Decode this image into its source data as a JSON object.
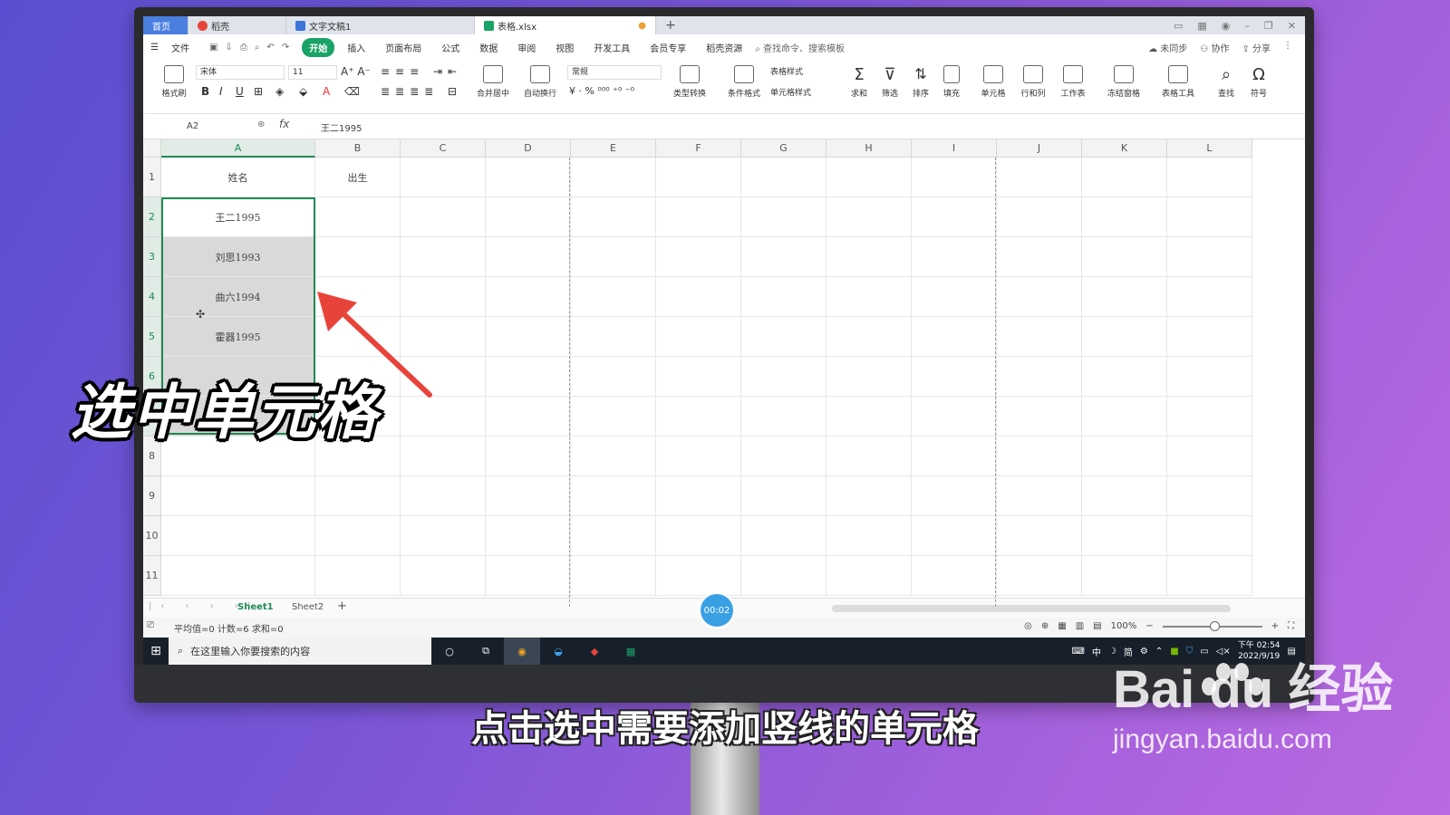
{
  "tabs": {
    "home": "首页",
    "wps": "稻壳",
    "doc": "文字文稿1",
    "sheet": "表格.xlsx",
    "plus": "+"
  },
  "menu": {
    "file": "文件",
    "items": [
      "开始",
      "插入",
      "页面布局",
      "公式",
      "数据",
      "审阅",
      "视图",
      "开发工具",
      "会员专享",
      "稻壳资源"
    ],
    "search": "查找命令、搜索模板",
    "sync": "未同步",
    "collab": "协作",
    "share": "分享"
  },
  "ribbon": {
    "format_painter": "格式刷",
    "font_name": "宋体",
    "font_size": "11",
    "merge_center": "合并居中",
    "wrap": "自动换行",
    "number_format": "常规",
    "convert": "类型转换",
    "cond_format": "条件格式",
    "table_style": "表格样式",
    "cell_style": "单元格样式",
    "sum": "求和",
    "filter": "筛选",
    "sort": "排序",
    "fill": "填充",
    "cell": "单元格",
    "rowcol": "行和列",
    "worksheet": "工作表",
    "freeze": "冻结窗格",
    "table_tools": "表格工具",
    "find": "查找",
    "symbol": "符号"
  },
  "formula_bar": {
    "name_box": "A2",
    "fx": "fx",
    "value": "王二1995"
  },
  "grid": {
    "columns": [
      "A",
      "B",
      "C",
      "D",
      "E",
      "F",
      "G",
      "H",
      "I",
      "J",
      "K",
      "L"
    ],
    "rows": [
      "1",
      "2",
      "3",
      "4",
      "5",
      "6",
      "7",
      "8",
      "9",
      "10",
      "11"
    ],
    "cells": {
      "A1": "姓名",
      "B1": "出生",
      "A2": "王二1995",
      "A3": "刘思1993",
      "A4": "曲六1994",
      "A5": "霍器1995"
    }
  },
  "sheets": [
    "Sheet1",
    "Sheet2"
  ],
  "status": {
    "summary": "平均值=0  计数=6  求和=0",
    "zoom": "100%"
  },
  "taskbar": {
    "search_placeholder": "在这里输入你要搜索的内容",
    "time": "下午 02:54",
    "date": "2022/9/19",
    "ime": "中",
    "ime_mode": "简"
  },
  "overlay": {
    "timer": "00:02",
    "title": "选中单元格",
    "caption": "点击选中需要添加竖线的单元格",
    "watermark_logo": "Bai du 经验",
    "watermark_url": "jingyan.baidu.com"
  },
  "colors": {
    "accent_green": "#1d8a54",
    "arrow_red": "#e8433a",
    "tab_blue": "#4a7fe0"
  }
}
